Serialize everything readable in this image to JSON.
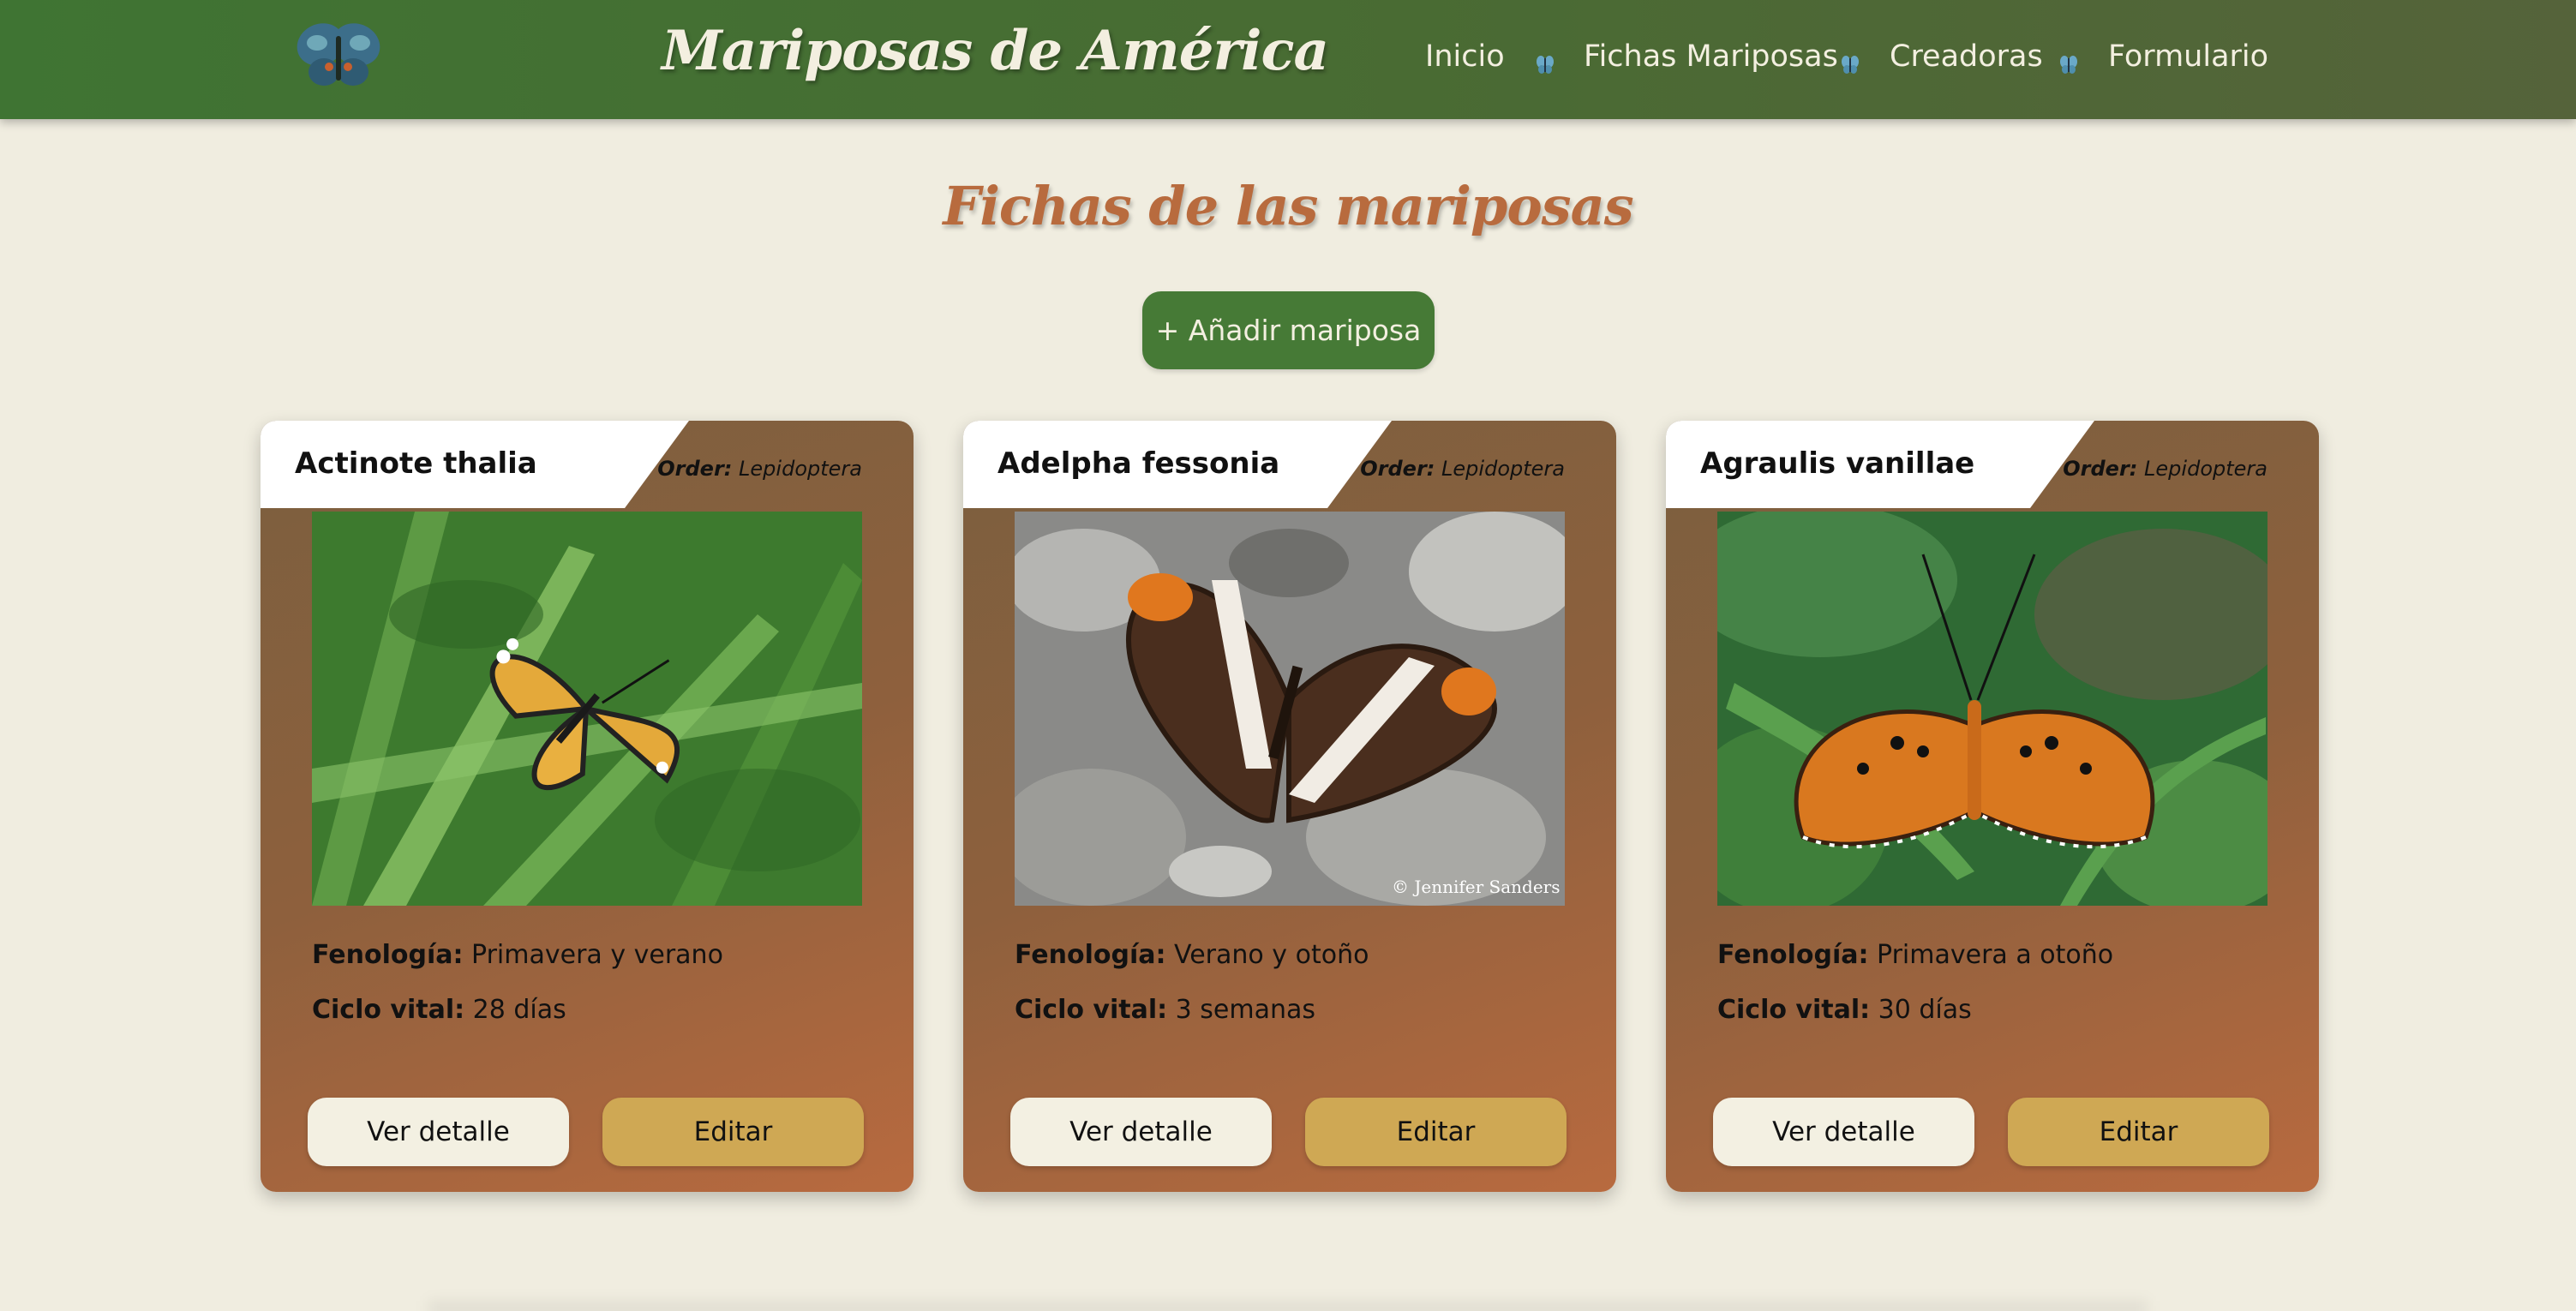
{
  "header": {
    "logo_icon": "butterfly-icon",
    "title": "Mariposas de América",
    "nav": [
      {
        "label": "Inicio"
      },
      {
        "label": "Fichas Mariposas"
      },
      {
        "label": "Creadoras"
      },
      {
        "label": "Formulario"
      }
    ],
    "separator_icon": "small-butterfly-icon"
  },
  "main": {
    "title": "Fichas de las mariposas",
    "add_button": "+ Añadir mariposa"
  },
  "cards": [
    {
      "name": "Actinote thalia",
      "order_label": "Order:",
      "order_value": "Lepidoptera",
      "photo_icon": "butterfly-photo",
      "phenology_label": "Fenología:",
      "phenology_value": "Primavera y verano",
      "cycle_label": "Ciclo vital:",
      "cycle_value": "28 días",
      "detail_button": "Ver detalle",
      "edit_button": "Editar"
    },
    {
      "name": "Adelpha fessonia",
      "order_label": "Order:",
      "order_value": "Lepidoptera",
      "photo_icon": "butterfly-photo",
      "photo_credit": "© Jennifer Sanders",
      "phenology_label": "Fenología:",
      "phenology_value": "Verano y otoño",
      "cycle_label": "Ciclo vital:",
      "cycle_value": "3 semanas",
      "detail_button": "Ver detalle",
      "edit_button": "Editar"
    },
    {
      "name": "Agraulis vanillae",
      "order_label": "Order:",
      "order_value": "Lepidoptera",
      "photo_icon": "butterfly-photo",
      "phenology_label": "Fenología:",
      "phenology_value": "Primavera a otoño",
      "cycle_label": "Ciclo vital:",
      "cycle_value": "30 días",
      "detail_button": "Ver detalle",
      "edit_button": "Editar"
    }
  ],
  "colors": {
    "header_green": "#467a36",
    "title_accent": "#b86b3e",
    "background": "#f0ede0",
    "edit_button": "#cfa854",
    "detail_button": "#f3f0e2"
  }
}
